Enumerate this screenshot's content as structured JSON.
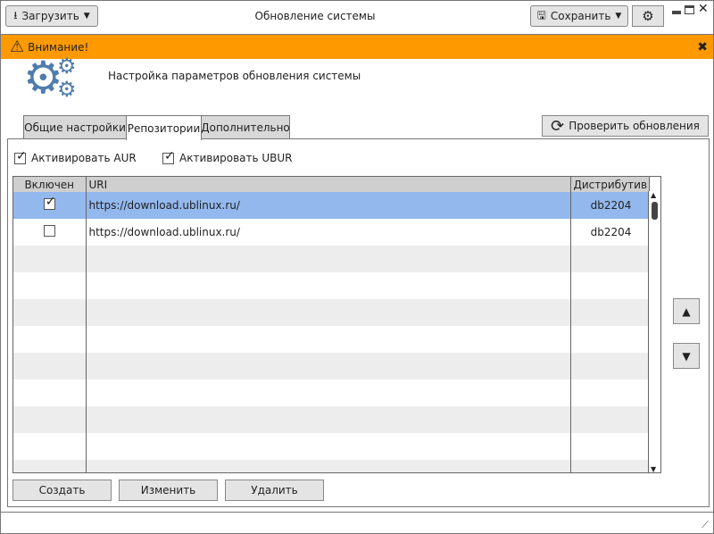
{
  "titlebar": {
    "title": "Обновление системы",
    "load_label": "Загрузить",
    "save_label": "Сохранить"
  },
  "banner": {
    "text": "Внимание!"
  },
  "header": {
    "subtitle": "Настройка параметров обновления системы"
  },
  "tabs": [
    {
      "label": "Общие настройки"
    },
    {
      "label": "Репозитории"
    },
    {
      "label": "Дополнительно"
    }
  ],
  "check_updates_label": "Проверить обновления",
  "options": {
    "aur_label": "Активировать AUR",
    "aur_checked": true,
    "ubur_label": "Активировать UBUR",
    "ubur_checked": true
  },
  "table": {
    "headers": [
      "Включен",
      "URI",
      "Дистрибутив"
    ],
    "rows": [
      {
        "enabled": true,
        "uri": "https://download.ublinux.ru/",
        "dist": "db2204"
      },
      {
        "enabled": false,
        "uri": "https://download.ublinux.ru/",
        "dist": "db2204"
      }
    ]
  },
  "actions": {
    "create": "Создать",
    "edit": "Изменить",
    "delete": "Удалить"
  },
  "colors": {
    "banner": "#ff9900",
    "selection": "#93b8ee",
    "gear": "#4f7cad"
  }
}
